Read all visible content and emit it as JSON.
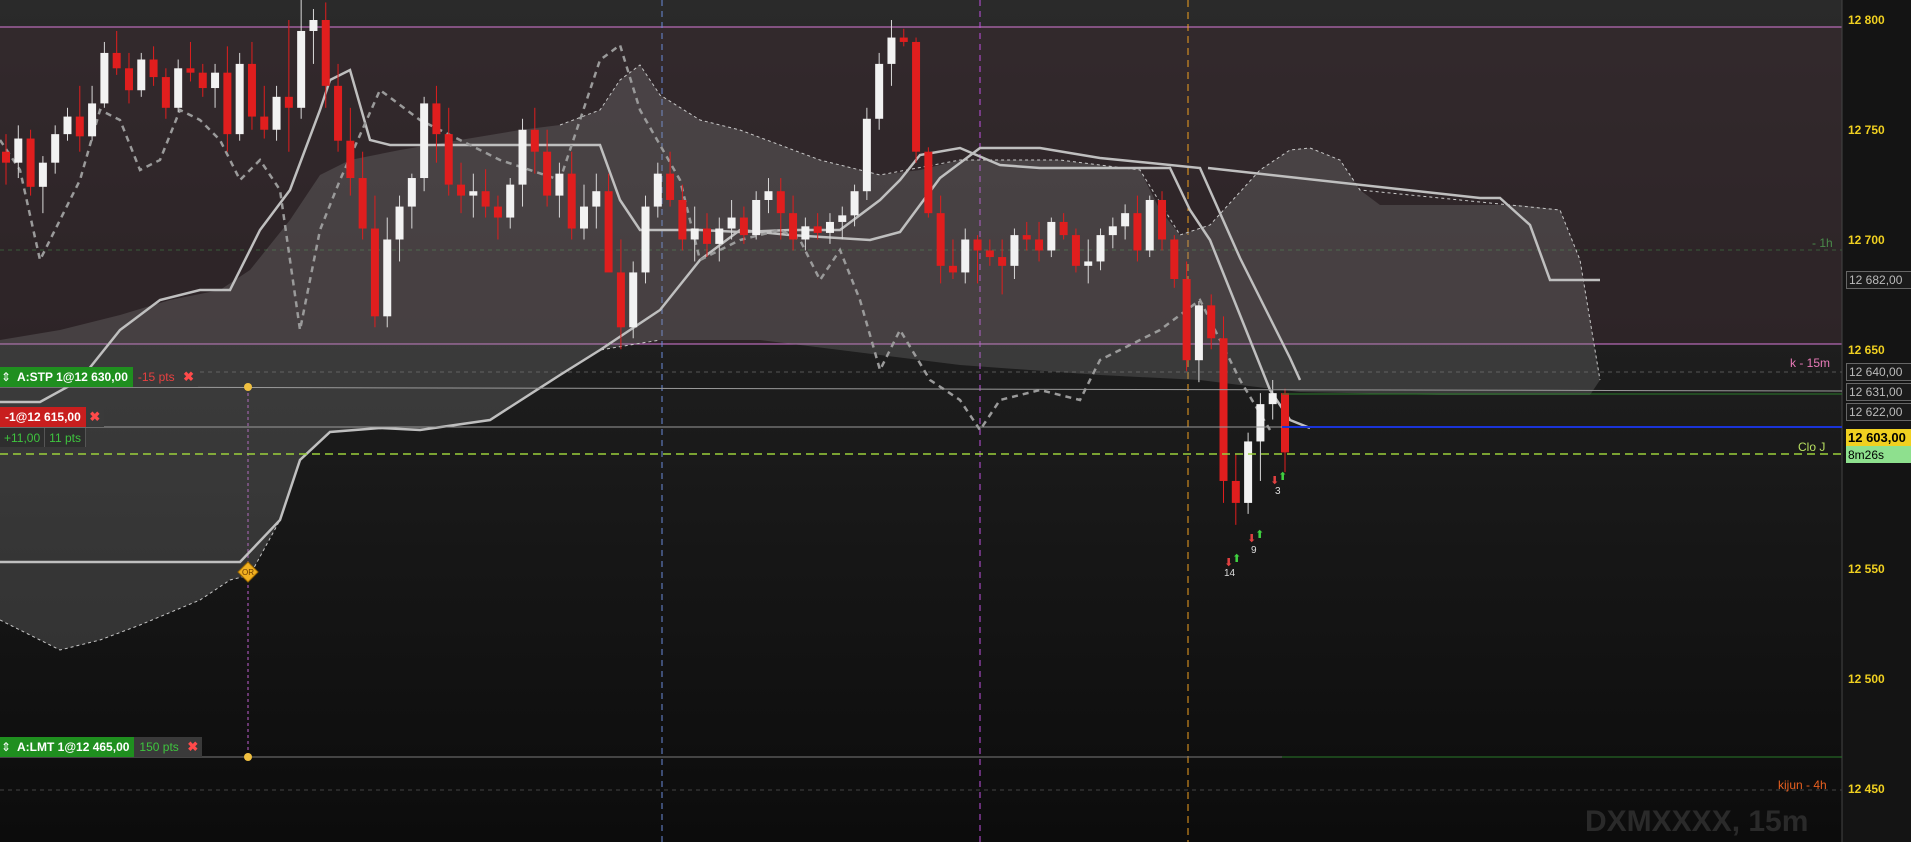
{
  "instrument": "DXMXXXX, 15m",
  "colors": {
    "up": "#f2f2f2",
    "down": "#e01e1e",
    "kijun": "#bfbfbf",
    "cloud": "#6a6a6a",
    "current_price": "#f0d020",
    "clo_line": "#9ad03a",
    "last_price_line": "#1a34d8"
  },
  "price_axis": {
    "ticks": [
      "12 800",
      "12 750",
      "12 700",
      "12 650",
      "12 550",
      "12 500",
      "12 450"
    ],
    "boxes": [
      "12 682,00",
      "12 640,00",
      "12 631,00",
      "12 622,00"
    ],
    "current_price": "12 603,00",
    "timer": "8m26s"
  },
  "right_labels": {
    "tf_1h": "- 1h",
    "k_15m": "k - 15m",
    "clo_j": "Clo J",
    "kijun_4h": "kijun - 4h"
  },
  "orders": {
    "stop": {
      "label": "A:STP 1@12 630,00",
      "pts": "-15 pts",
      "price": 12630
    },
    "position": {
      "label": "-1@12 615,00",
      "price": 12615
    },
    "pnl": {
      "value": "+11,00",
      "pts": "11 pts"
    },
    "limit": {
      "label": "A:LMT 1@12 465,00",
      "pts": "150 pts",
      "price": 12465
    }
  },
  "markers": {
    "m14": "14",
    "m9": "9",
    "m3": "3",
    "or_badge": "OR"
  },
  "chart_data": {
    "type": "candlestick",
    "timeframe": "15m",
    "ylim": [
      12420,
      12810
    ],
    "current_price": 12603,
    "candles": [
      [
        12740,
        12748,
        12725,
        12735
      ],
      [
        12735,
        12752,
        12728,
        12746
      ],
      [
        12746,
        12750,
        12720,
        12724
      ],
      [
        12724,
        12738,
        12712,
        12735
      ],
      [
        12735,
        12752,
        12730,
        12748
      ],
      [
        12748,
        12760,
        12745,
        12756
      ],
      [
        12756,
        12770,
        12740,
        12747
      ],
      [
        12747,
        12770,
        12745,
        12762
      ],
      [
        12762,
        12790,
        12760,
        12785
      ],
      [
        12785,
        12795,
        12775,
        12778
      ],
      [
        12778,
        12785,
        12762,
        12768
      ],
      [
        12768,
        12785,
        12765,
        12782
      ],
      [
        12782,
        12788,
        12770,
        12774
      ],
      [
        12774,
        12778,
        12755,
        12760
      ],
      [
        12760,
        12782,
        12758,
        12778
      ],
      [
        12778,
        12790,
        12772,
        12776
      ],
      [
        12776,
        12780,
        12765,
        12769
      ],
      [
        12769,
        12780,
        12760,
        12776
      ],
      [
        12776,
        12788,
        12740,
        12748
      ],
      [
        12748,
        12785,
        12745,
        12780
      ],
      [
        12780,
        12790,
        12750,
        12756
      ],
      [
        12756,
        12770,
        12746,
        12750
      ],
      [
        12750,
        12770,
        12745,
        12765
      ],
      [
        12765,
        12800,
        12740,
        12760
      ],
      [
        12760,
        12810,
        12755,
        12795
      ],
      [
        12795,
        12805,
        12780,
        12800
      ],
      [
        12800,
        12808,
        12760,
        12770
      ],
      [
        12770,
        12780,
        12740,
        12745
      ],
      [
        12745,
        12760,
        12720,
        12728
      ],
      [
        12728,
        12740,
        12700,
        12705
      ],
      [
        12705,
        12720,
        12660,
        12665
      ],
      [
        12665,
        12710,
        12660,
        12700
      ],
      [
        12700,
        12720,
        12690,
        12715
      ],
      [
        12715,
        12730,
        12705,
        12728
      ],
      [
        12728,
        12765,
        12722,
        12762
      ],
      [
        12762,
        12770,
        12735,
        12748
      ],
      [
        12748,
        12760,
        12720,
        12725
      ],
      [
        12725,
        12735,
        12712,
        12720
      ],
      [
        12720,
        12730,
        12710,
        12722
      ],
      [
        12722,
        12732,
        12710,
        12715
      ],
      [
        12715,
        12720,
        12700,
        12710
      ],
      [
        12710,
        12728,
        12705,
        12725
      ],
      [
        12725,
        12755,
        12715,
        12750
      ],
      [
        12750,
        12760,
        12730,
        12740
      ],
      [
        12740,
        12750,
        12715,
        12720
      ],
      [
        12720,
        12735,
        12710,
        12730
      ],
      [
        12730,
        12740,
        12700,
        12705
      ],
      [
        12705,
        12725,
        12700,
        12715
      ],
      [
        12715,
        12730,
        12705,
        12722
      ],
      [
        12722,
        12730,
        12700,
        12685
      ],
      [
        12685,
        12700,
        12650,
        12660
      ],
      [
        12660,
        12690,
        12655,
        12685
      ],
      [
        12685,
        12720,
        12680,
        12715
      ],
      [
        12715,
        12735,
        12710,
        12730
      ],
      [
        12730,
        12740,
        12715,
        12718
      ],
      [
        12718,
        12725,
        12695,
        12700
      ],
      [
        12700,
        12715,
        12690,
        12705
      ],
      [
        12705,
        12712,
        12692,
        12698
      ],
      [
        12698,
        12710,
        12690,
        12705
      ],
      [
        12705,
        12718,
        12700,
        12710
      ],
      [
        12710,
        12715,
        12698,
        12702
      ],
      [
        12702,
        12722,
        12700,
        12718
      ],
      [
        12718,
        12728,
        12712,
        12722
      ],
      [
        12722,
        12728,
        12700,
        12712
      ],
      [
        12712,
        12720,
        12695,
        12700
      ],
      [
        12700,
        12710,
        12695,
        12706
      ],
      [
        12706,
        12712,
        12700,
        12703
      ],
      [
        12703,
        12712,
        12698,
        12708
      ],
      [
        12708,
        12715,
        12700,
        12711
      ],
      [
        12711,
        12725,
        12706,
        12722
      ],
      [
        12722,
        12760,
        12718,
        12755
      ],
      [
        12755,
        12785,
        12750,
        12780
      ],
      [
        12780,
        12800,
        12770,
        12792
      ],
      [
        12792,
        12796,
        12788,
        12790
      ],
      [
        12790,
        12792,
        12735,
        12740
      ],
      [
        12740,
        12742,
        12710,
        12712
      ],
      [
        12712,
        12720,
        12680,
        12688
      ],
      [
        12688,
        12700,
        12682,
        12685
      ],
      [
        12685,
        12705,
        12680,
        12700
      ],
      [
        12700,
        12702,
        12680,
        12695
      ],
      [
        12695,
        12700,
        12688,
        12692
      ],
      [
        12692,
        12700,
        12675,
        12688
      ],
      [
        12688,
        12705,
        12682,
        12702
      ],
      [
        12702,
        12708,
        12695,
        12700
      ],
      [
        12700,
        12708,
        12690,
        12695
      ],
      [
        12695,
        12710,
        12692,
        12708
      ],
      [
        12708,
        12712,
        12700,
        12702
      ],
      [
        12702,
        12705,
        12685,
        12688
      ],
      [
        12688,
        12700,
        12680,
        12690
      ],
      [
        12690,
        12705,
        12686,
        12702
      ],
      [
        12702,
        12710,
        12696,
        12706
      ],
      [
        12706,
        12716,
        12700,
        12712
      ],
      [
        12712,
        12720,
        12690,
        12695
      ],
      [
        12695,
        12720,
        12692,
        12718
      ],
      [
        12718,
        12722,
        12695,
        12700
      ],
      [
        12700,
        12702,
        12678,
        12682
      ],
      [
        12682,
        12690,
        12640,
        12645
      ],
      [
        12645,
        12672,
        12635,
        12670
      ],
      [
        12670,
        12675,
        12650,
        12655
      ],
      [
        12655,
        12665,
        12580,
        12590
      ],
      [
        12590,
        12602,
        12570,
        12580
      ],
      [
        12580,
        12612,
        12575,
        12608
      ],
      [
        12608,
        12630,
        12590,
        12625
      ],
      [
        12625,
        12636,
        12618,
        12630
      ],
      [
        12630,
        12632,
        12594,
        12603
      ]
    ]
  }
}
